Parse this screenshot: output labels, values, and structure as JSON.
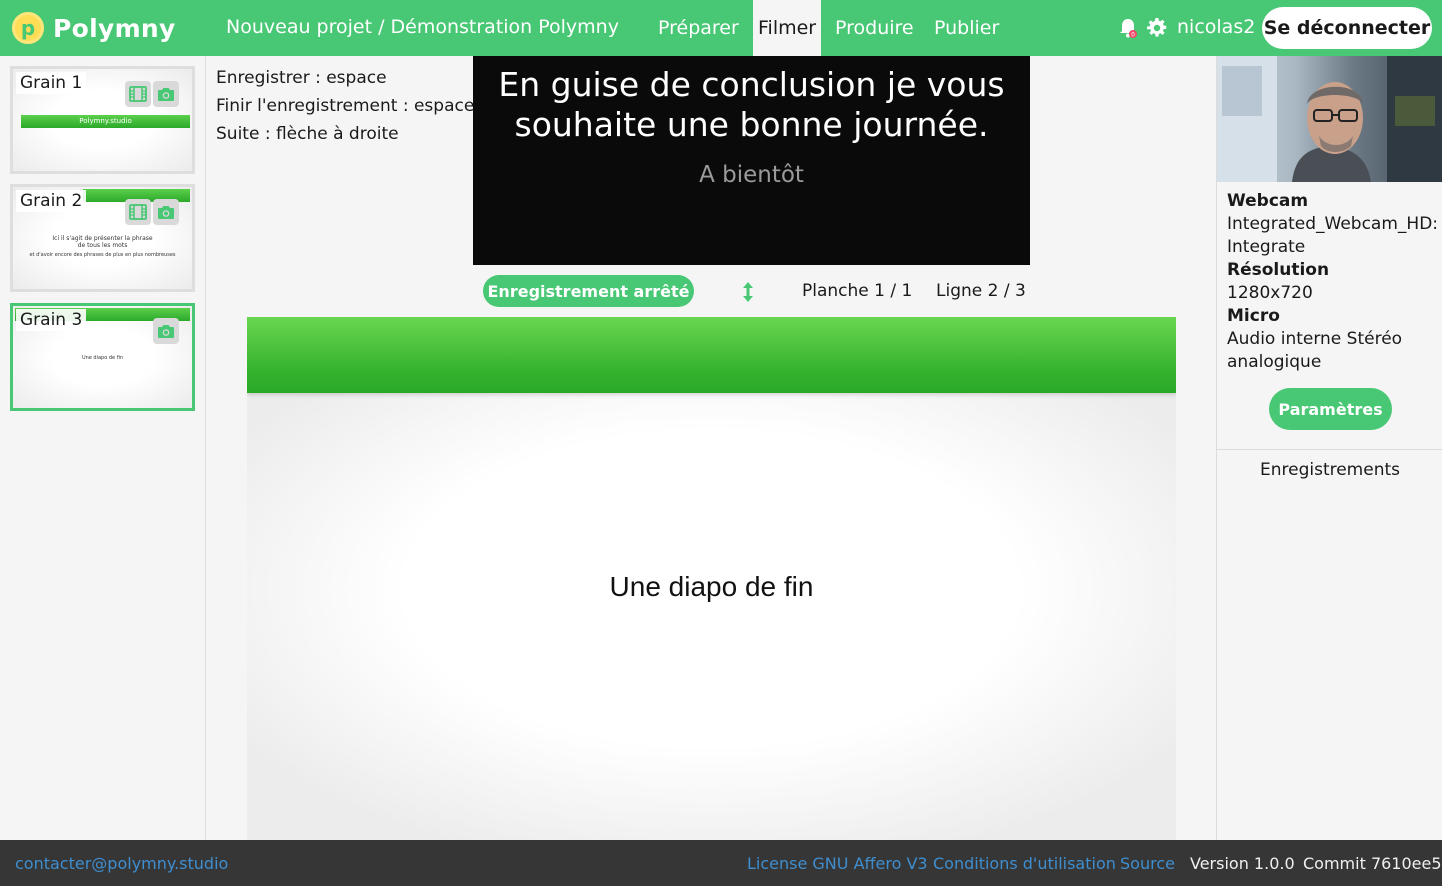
{
  "brand": {
    "logo_letter": "p",
    "name": "Polymny"
  },
  "breadcrumb": "Nouveau projet / Démonstration Polymny",
  "nav": {
    "prepare": "Préparer",
    "film": "Filmer",
    "produce": "Produire",
    "publish": "Publier",
    "active": "Filmer"
  },
  "user": {
    "name": "nicolas2",
    "logout_label": "Se déconnecter",
    "notification_count": "0"
  },
  "grains": [
    {
      "label": "Grain 1",
      "thumb_text": "Polymny.studio",
      "has_video": true
    },
    {
      "label": "Grain 2",
      "thumb_lines": [
        "Ici il s'agit de présenter la phrase",
        "de tous les mots",
        "et d'avoir encore des phrases de plus en plus nombreuses"
      ],
      "has_video": true
    },
    {
      "label": "Grain 3",
      "thumb_text": "Une diapo de fin",
      "has_video": false,
      "selected": true
    }
  ],
  "instructions": {
    "record": "Enregistrer : espace",
    "finish": "Finir l'enregistrement : espace",
    "next": "Suite : flèche à droite"
  },
  "prompter": {
    "current": "En guise de conclusion je vous souhaite une bonne journée.",
    "next": "A bientôt"
  },
  "recording": {
    "status": "Enregistrement arrêté",
    "slide_counter": "Planche 1 / 1",
    "line_counter": "Ligne 2 / 3"
  },
  "slide": {
    "text": "Une diapo de fin"
  },
  "device_info": {
    "webcam_label": "Webcam",
    "webcam_value": "Integrated_Webcam_HD: Integrate",
    "resolution_label": "Résolution",
    "resolution_value": "1280x720",
    "micro_label": "Micro",
    "micro_value": "Audio interne Stéréo analogique",
    "params_button": "Paramètres",
    "recordings_heading": "Enregistrements"
  },
  "footer": {
    "contact": "contacter@polymny.studio",
    "license": "License GNU Affero V3",
    "terms": "Conditions d'utilisation",
    "source": "Source",
    "version": "Version 1.0.0",
    "commit": "Commit 7610ee5"
  },
  "colors": {
    "accent": "#48c774",
    "footer_bg": "#363636",
    "link": "#3e8ed0",
    "prompter_bg": "#0a0a0a"
  }
}
